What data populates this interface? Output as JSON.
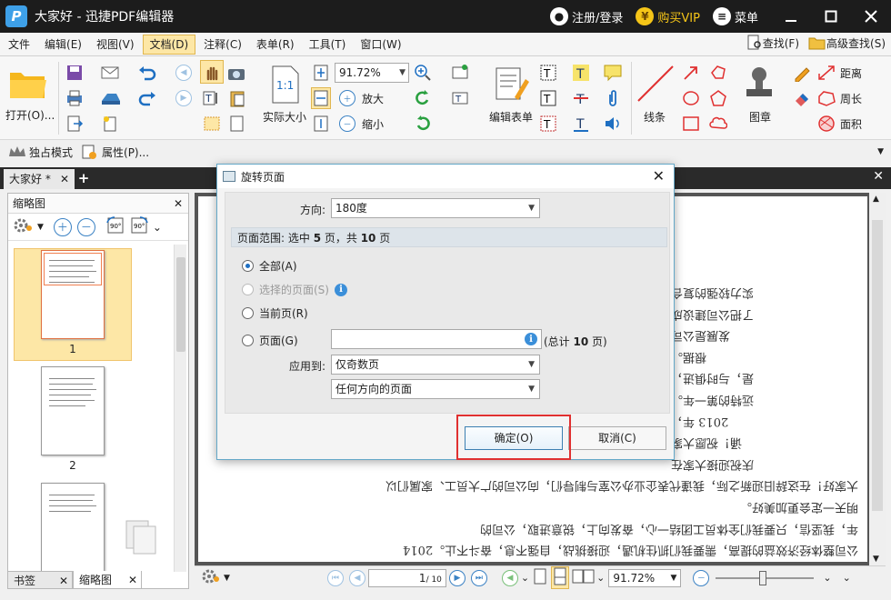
{
  "app": {
    "title": "大家好 - 迅捷PDF编辑器",
    "logo_letter": "P",
    "register_label": "注册/登录",
    "vip_label": "购买VIP",
    "menu_label": "菜单"
  },
  "menubar": {
    "items": [
      "文件",
      "编辑(E)",
      "视图(V)",
      "文档(D)",
      "注释(C)",
      "表单(R)",
      "工具(T)",
      "窗口(W)"
    ],
    "find": "查找(F)",
    "advanced_find": "高级查找(S)"
  },
  "toolbar": {
    "open": "打开(O)...",
    "zoom_value": "91.72%",
    "actual_size": "实际大小",
    "zoom_in": "放大",
    "zoom_out": "缩小",
    "edit_form": "编辑表单",
    "line": "线条",
    "stamp": "图章",
    "distance": "距离",
    "perimeter": "周长",
    "area": "面积"
  },
  "toolbar2": {
    "exclusive_mode": "独占模式",
    "properties": "属性(P)..."
  },
  "tabs": {
    "doc_tab": "大家好 *"
  },
  "leftpanel": {
    "title": "缩略图",
    "thumbs": [
      "1",
      "2"
    ],
    "bottom_tabs": [
      "书签",
      "缩略图"
    ]
  },
  "document": {
    "upside_lines": [
      "实力较强的复合",
      "了把公司建设成",
      "发展是公司",
      "根据。",
      "是，与时俱进，",
      "远特的第一年。",
      "2013 年，",
      "诵！祝愿大家",
      "庆祝迎接大家在",
      "大家好！在这辞旧迎新之际，我谨代表企业办公室与制导们，向公司的广大员工、家属们以",
      "明天一定会更加美好。",
      "年，我坚信，只要我们全体员工团结一心，奋发向上，锐意进取，公司的",
      "公司整体经济效益的提高，需要我们抓住机遇，迎接挑战，自强不息，奋斗不止。2014"
    ]
  },
  "statusbar": {
    "page_current": "1",
    "page_total": "/ 10",
    "zoom": "91.72%"
  },
  "dialog": {
    "title": "旋转页面",
    "direction_label": "方向:",
    "direction_value": "180度",
    "range_prefix": "页面范围: 选中 ",
    "range_selected": "5",
    "range_mid": " 页，共 ",
    "range_total": "10",
    "range_suffix": " 页",
    "opt_all": "全部(A)",
    "opt_selected": "选择的页面(S)",
    "opt_current": "当前页(R)",
    "opt_pages": "页面(G)",
    "pages_input_value": "",
    "total_pages_prefix": "(总计 ",
    "total_pages_num": "10",
    "total_pages_suffix": " 页)",
    "apply_label": "应用到:",
    "apply_value": "仅奇数页",
    "orientation_value": "任何方向的页面",
    "ok": "确定(O)",
    "cancel": "取消(C)"
  },
  "colors": {
    "titlebar": "#1c1c1c",
    "accent_blue": "#3b82c4",
    "highlight": "#fde7a6",
    "annotation_red": "#e03030"
  }
}
